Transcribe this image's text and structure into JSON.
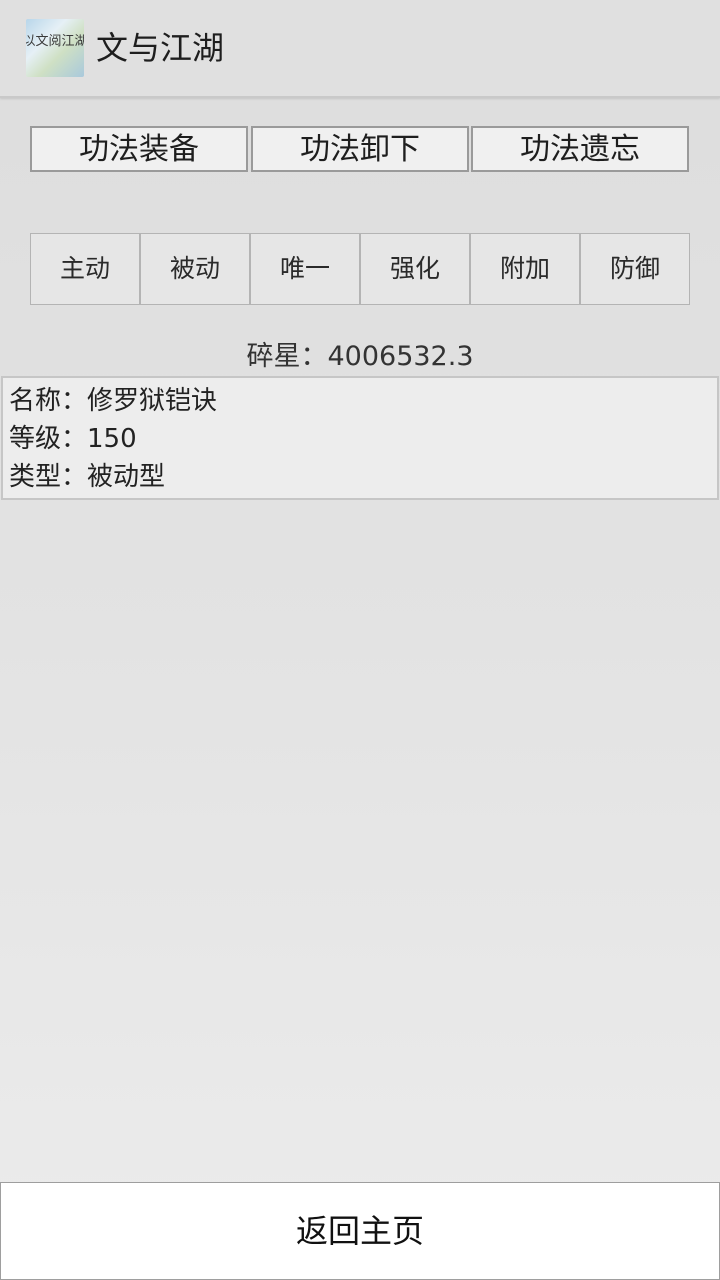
{
  "app": {
    "title": "文与江湖",
    "icon": "app-logo-icon",
    "icon_text": "以文阅江湖"
  },
  "action_tabs": [
    {
      "label": "功法装备"
    },
    {
      "label": "功法卸下"
    },
    {
      "label": "功法遗忘"
    }
  ],
  "categories": [
    {
      "label": "主动"
    },
    {
      "label": "被动"
    },
    {
      "label": "唯一"
    },
    {
      "label": "强化"
    },
    {
      "label": "附加"
    },
    {
      "label": "防御"
    }
  ],
  "currency": {
    "label": "碎星：4006532.3"
  },
  "skill_info": {
    "name_line": "名称：修罗狱铠诀",
    "level_line": "等级：150",
    "type_line": "类型：被动型"
  },
  "footer": {
    "return_label": "返回主页"
  }
}
